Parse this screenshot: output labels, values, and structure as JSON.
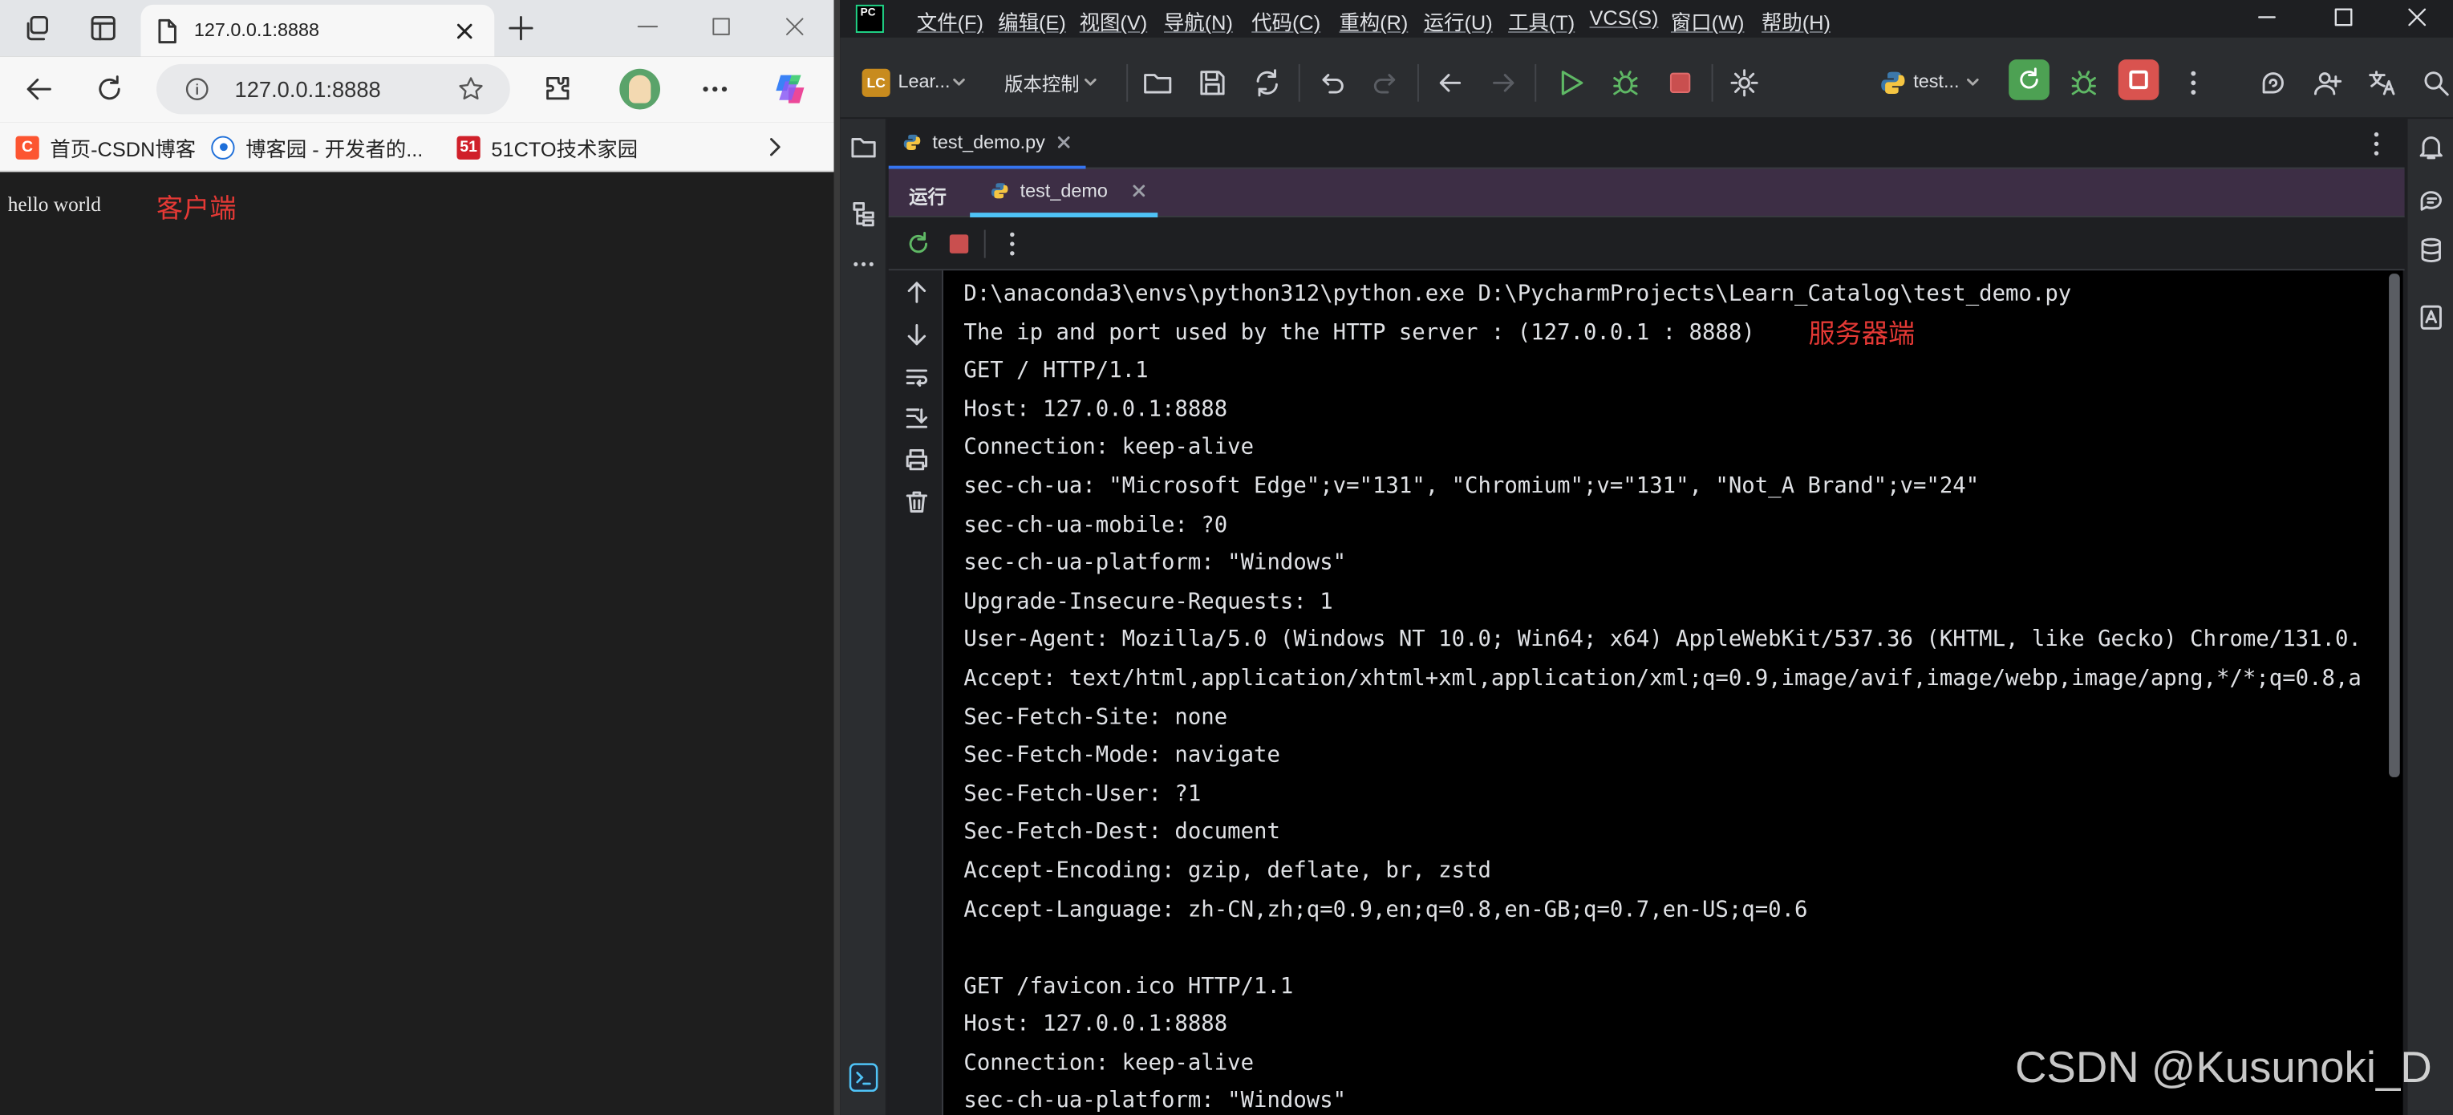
{
  "browser": {
    "tab_title": "127.0.0.1:8888",
    "address": "127.0.0.1:8888",
    "bookmarks": [
      {
        "label": "首页-CSDN博客",
        "badge": "C",
        "color": "#fc5531"
      },
      {
        "label": "博客园 - 开发者的...",
        "badge": "",
        "color": "#1e6fd9"
      },
      {
        "label": "51CTO技术家园",
        "badge": "51",
        "color": "#d0202a"
      }
    ],
    "page_text": "hello world",
    "annotation": "客户端"
  },
  "ide": {
    "menus": [
      "文件(F)",
      "编辑(E)",
      "视图(V)",
      "导航(N)",
      "代码(C)",
      "重构(R)",
      "运行(U)",
      "工具(T)",
      "VCS(S)",
      "窗口(W)",
      "帮助(H)"
    ],
    "project_badge": "LC",
    "project_name": "Lear...",
    "vcs_label": "版本控制",
    "run_config": "test...",
    "editor_tab": "test_demo.py",
    "run_label": "运行",
    "run_tab": "test_demo",
    "server_annotation": "服务器端",
    "console_lines": [
      "D:\\anaconda3\\envs\\python312\\python.exe D:\\PycharmProjects\\Learn_Catalog\\test_demo.py",
      "The ip and port used by the HTTP server : (127.0.0.1 : 8888)",
      "GET / HTTP/1.1",
      "Host: 127.0.0.1:8888",
      "Connection: keep-alive",
      "sec-ch-ua: \"Microsoft Edge\";v=\"131\", \"Chromium\";v=\"131\", \"Not_A Brand\";v=\"24\"",
      "sec-ch-ua-mobile: ?0",
      "sec-ch-ua-platform: \"Windows\"",
      "Upgrade-Insecure-Requests: 1",
      "User-Agent: Mozilla/5.0 (Windows NT 10.0; Win64; x64) AppleWebKit/537.36 (KHTML, like Gecko) Chrome/131.0.",
      "Accept: text/html,application/xhtml+xml,application/xml;q=0.9,image/avif,image/webp,image/apng,*/*;q=0.8,a",
      "Sec-Fetch-Site: none",
      "Sec-Fetch-Mode: navigate",
      "Sec-Fetch-User: ?1",
      "Sec-Fetch-Dest: document",
      "Accept-Encoding: gzip, deflate, br, zstd",
      "Accept-Language: zh-CN,zh;q=0.9,en;q=0.8,en-GB;q=0.7,en-US;q=0.6",
      "",
      "GET /favicon.ico HTTP/1.1",
      "Host: 127.0.0.1:8888",
      "Connection: keep-alive",
      "sec-ch-ua-platform: \"Windows\""
    ]
  },
  "watermark": "CSDN @Kusunoki_D"
}
